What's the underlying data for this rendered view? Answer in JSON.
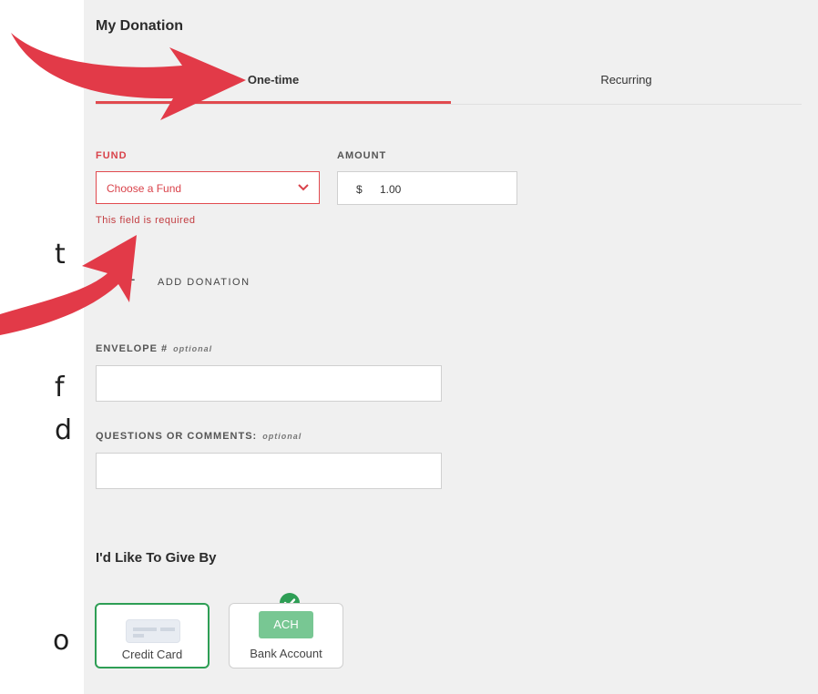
{
  "side_text": [
    "t",
    "f",
    "d",
    "o"
  ],
  "form": {
    "title": "My Donation",
    "tabs": [
      {
        "label": "One-time",
        "active": true
      },
      {
        "label": "Recurring",
        "active": false
      }
    ],
    "fund": {
      "label": "FUND",
      "value": "Choose a Fund",
      "error": "This field is required"
    },
    "amount": {
      "label": "AMOUNT",
      "currency": "$",
      "value": "1.00"
    },
    "add_donation": {
      "icon": "+",
      "label": "ADD DONATION"
    },
    "envelope": {
      "label": "ENVELOPE #",
      "optional": "optional",
      "value": ""
    },
    "comments": {
      "label": "QUESTIONS OR COMMENTS:",
      "optional": "optional",
      "value": ""
    },
    "give_by": {
      "title": "I'd Like To Give By",
      "options": [
        {
          "label": "Credit Card",
          "selected": true,
          "icon": "credit-card-icon"
        },
        {
          "label": "Bank Account",
          "selected": false,
          "icon": "ach-icon",
          "icon_text": "ACH"
        }
      ]
    }
  },
  "colors": {
    "accent_red": "#e14a4f",
    "error_red": "#d9424a",
    "success_green": "#2e9e55",
    "ach_green": "#78c793",
    "panel_bg": "#f0f0f0",
    "annotation_arrow": "#e23a48"
  }
}
